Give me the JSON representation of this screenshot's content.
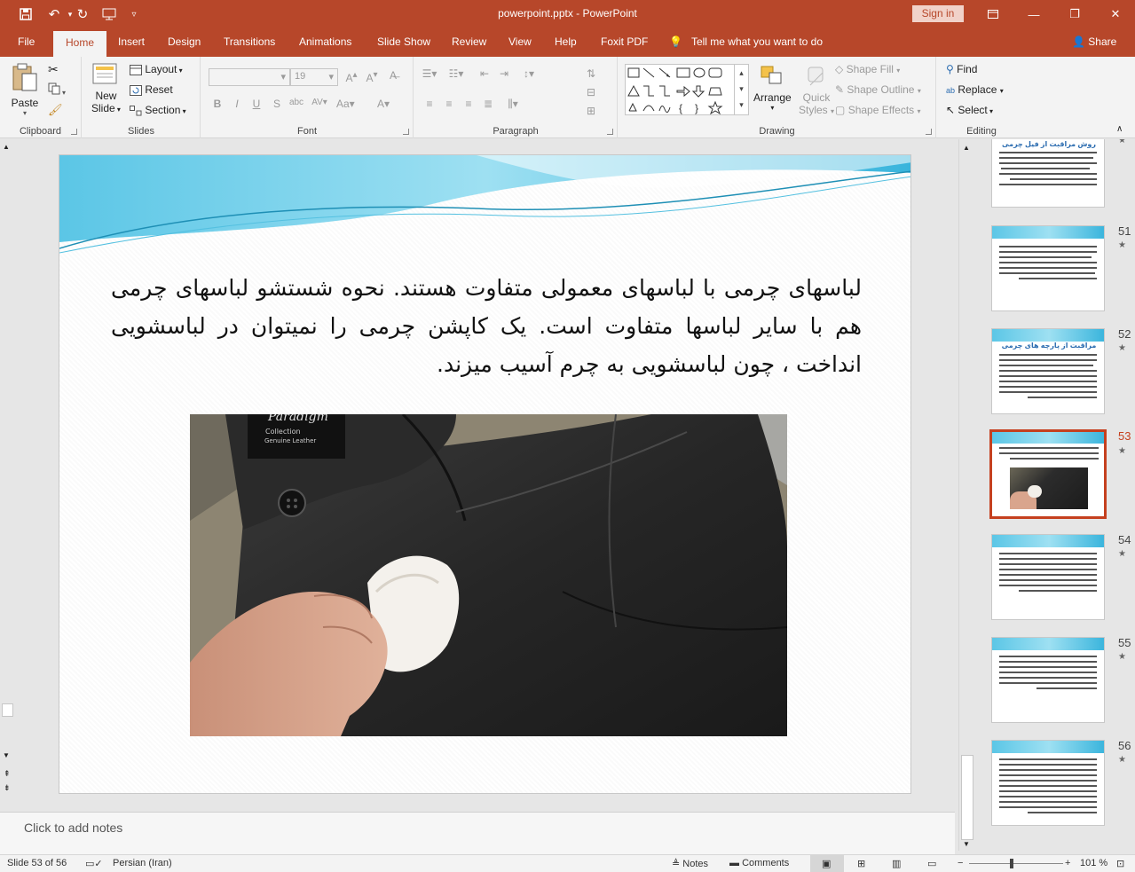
{
  "window": {
    "title": "powerpoint.pptx  -  PowerPoint",
    "signin": "Sign in",
    "share": "Share",
    "tell_me": "Tell me what you want to do"
  },
  "tabs": [
    "File",
    "Home",
    "Insert",
    "Design",
    "Transitions",
    "Animations",
    "Slide Show",
    "Review",
    "View",
    "Help",
    "Foxit PDF"
  ],
  "active_tab": "Home",
  "ribbon": {
    "clipboard": {
      "label": "Clipboard",
      "paste": "Paste"
    },
    "slides": {
      "label": "Slides",
      "new_slide": "New",
      "new_slide2": "Slide",
      "layout": "Layout",
      "reset": "Reset",
      "section": "Section"
    },
    "font": {
      "label": "Font",
      "font_size": "19"
    },
    "paragraph": {
      "label": "Paragraph"
    },
    "drawing": {
      "label": "Drawing",
      "arrange": "Arrange",
      "quick_styles": "Quick",
      "quick_styles2": "Styles",
      "shape_fill": "Shape Fill",
      "shape_outline": "Shape Outline",
      "shape_effects": "Shape Effects"
    },
    "editing": {
      "label": "Editing",
      "find": "Find",
      "replace": "Replace",
      "select": "Select"
    }
  },
  "slide": {
    "text": "لباسهای چرمی با لباسهای معمولی متفاوت هستند. نحوه شستشو لباسهای چرمی هم با سایر لباسها متفاوت است. یک کاپشن چرمی را نمیتوان در لباسشویی انداخت ، چون لباسشویی به چرم آسیب میزند."
  },
  "photo": {
    "brand": "Paradigm",
    "collection": "Collection",
    "genuine": "Genuine Leather"
  },
  "thumbnails": [
    {
      "num": "",
      "title": "روش مراقبت از فیل چرمی"
    },
    {
      "num": "51",
      "title": ""
    },
    {
      "num": "52",
      "title": "مراقبت از پارچه های چرمی"
    },
    {
      "num": "53",
      "title": "",
      "selected": true
    },
    {
      "num": "54",
      "title": ""
    },
    {
      "num": "55",
      "title": ""
    },
    {
      "num": "56",
      "title": ""
    }
  ],
  "notes_placeholder": "Click to add notes",
  "status": {
    "slide_info": "Slide 53 of 56",
    "language": "Persian (Iran)",
    "notes": "Notes",
    "comments": "Comments",
    "zoom": "101 %"
  },
  "colors": {
    "accent": "#b7472a",
    "selection": "#c5401f"
  }
}
